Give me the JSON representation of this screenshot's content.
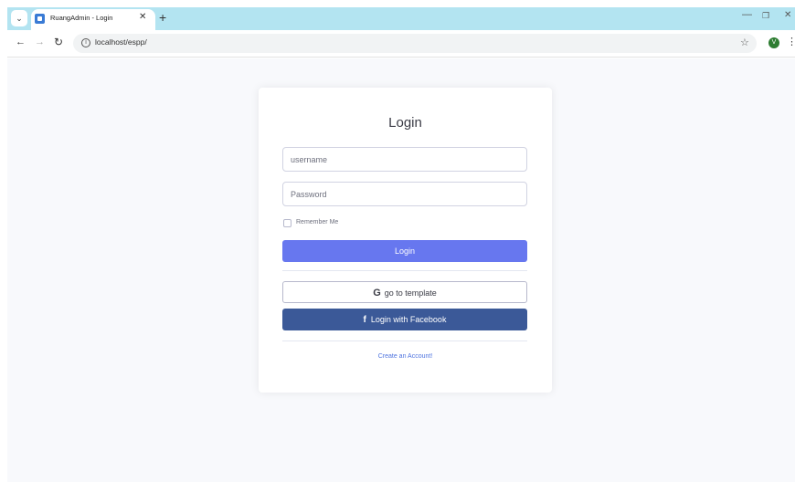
{
  "browser": {
    "tab_title": "RuangAdmin - Login",
    "url": "localhost/espp/",
    "profile_initial": "V"
  },
  "login": {
    "title": "Login",
    "username_placeholder": "username",
    "password_placeholder": "Password",
    "remember_label": "Remember Me",
    "login_button": "Login",
    "google_button": "go to template",
    "facebook_button": "Login with Facebook",
    "create_account": "Create an Account!"
  },
  "colors": {
    "primary": "#6777ef",
    "facebook": "#3b5998",
    "link": "#4e73df",
    "tabstrip": "#b3e4f1"
  }
}
